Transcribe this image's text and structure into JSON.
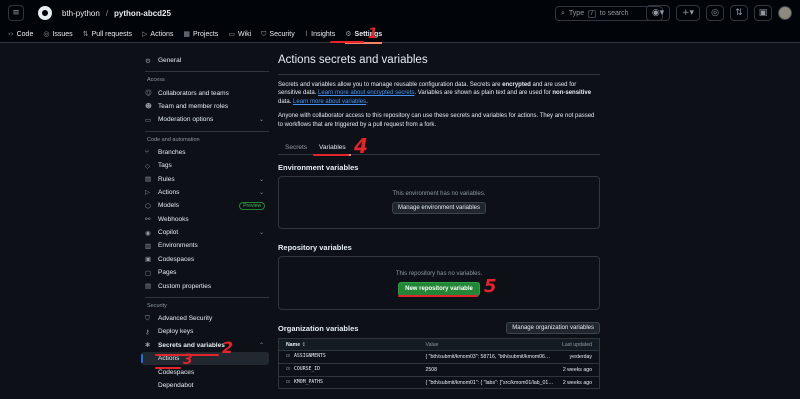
{
  "header": {
    "owner": "bth-python",
    "separator": "/",
    "repo": "python-abcd25",
    "search_prefix": "Type",
    "search_key": "/",
    "search_suffix": "to search",
    "icons": [
      "menu-icon",
      "github-logo-icon",
      "search-icon",
      "copilot-icon",
      "plus-icon",
      "issues-icon",
      "pull-requests-icon",
      "inbox-icon",
      "avatar"
    ]
  },
  "repo_nav": {
    "tabs": [
      {
        "label": "Code",
        "icon": "‹›"
      },
      {
        "label": "Issues",
        "icon": "◎"
      },
      {
        "label": "Pull requests",
        "icon": "⇅"
      },
      {
        "label": "Actions",
        "icon": "▷"
      },
      {
        "label": "Projects",
        "icon": "▦"
      },
      {
        "label": "Wiki",
        "icon": "▭"
      },
      {
        "label": "Security",
        "icon": "⛉"
      },
      {
        "label": "Insights",
        "icon": "⌇"
      },
      {
        "label": "Settings",
        "icon": "⚙"
      }
    ]
  },
  "sidebar": {
    "general": "General",
    "access_heading": "Access",
    "access": [
      "Collaborators and teams",
      "Team and member roles",
      "Moderation options"
    ],
    "code_heading": "Code and automation",
    "code": [
      "Branches",
      "Tags",
      "Rules",
      "Actions",
      "Models",
      "Webhooks",
      "Copilot",
      "Environments",
      "Codespaces",
      "Pages",
      "Custom properties"
    ],
    "models_badge": "Preview",
    "security_heading": "Security",
    "security": [
      "Advanced Security",
      "Deploy keys",
      "Secrets and variables"
    ],
    "secrets_sub": [
      "Actions",
      "Codespaces",
      "Dependabot"
    ]
  },
  "main": {
    "title": "Actions secrets and variables",
    "p1_a": "Secrets and variables allow you to manage reusable configuration data. Secrets are ",
    "p1_b": "encrypted",
    "p1_c": " and are used for sensitive data. ",
    "p1_link1": "Learn more about encrypted secrets",
    "p1_d": ". Variables are shown as plain text and are used for ",
    "p1_e": "non-sensitive",
    "p1_f": " data. ",
    "p1_link2": "Learn more about variables",
    "p1_g": ".",
    "p2": "Anyone with collaborator access to this repository can use these secrets and variables for actions. They are not passed to workflows that are triggered by a pull request from a fork.",
    "tabs": [
      "Secrets",
      "Variables"
    ],
    "env_title": "Environment variables",
    "env_empty": "This environment has no variables.",
    "env_button": "Manage environment variables",
    "repo_title": "Repository variables",
    "repo_empty": "This repository has no variables.",
    "repo_button": "New repository variable",
    "org_title": "Organization variables",
    "org_button": "Manage organization variables",
    "table": {
      "headers": [
        "Name",
        "Value",
        "Last updated"
      ],
      "sort_icon": "↕",
      "rows": [
        {
          "name": "ASSIGNMENTS",
          "value": "{ \"bth/submit/kmom03\": 58716, \"bth/submit/kmom06…",
          "updated": "yesterday"
        },
        {
          "name": "COURSE_ID",
          "value": "2508",
          "updated": "2 weeks ago"
        },
        {
          "name": "KMOM_PATHS",
          "value": "{ \"bth/submit/kmom01\": { \"labs\": [\"src/kmom01/lab_01…",
          "updated": "2 weeks ago"
        }
      ]
    }
  },
  "annotations": [
    "1",
    "2",
    "3",
    "4",
    "5"
  ]
}
